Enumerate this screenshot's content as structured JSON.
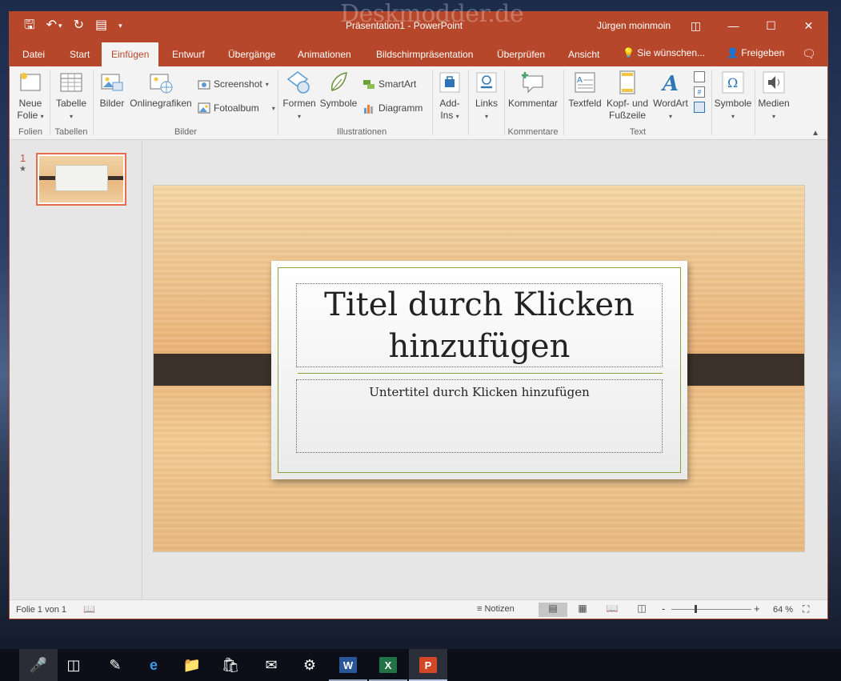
{
  "watermark": "Deskmodder.de",
  "window": {
    "title": "Präsentation1 - PowerPoint",
    "user": "Jürgen moinmoin",
    "accent": "#b7472a"
  },
  "tabs": [
    {
      "label": "Datei"
    },
    {
      "label": "Start"
    },
    {
      "label": "Einfügen"
    },
    {
      "label": "Entwurf"
    },
    {
      "label": "Übergänge"
    },
    {
      "label": "Animationen"
    },
    {
      "label": "Bildschirmpräsentation"
    },
    {
      "label": "Überprüfen"
    },
    {
      "label": "Ansicht"
    }
  ],
  "tell_me": "Sie wünschen...",
  "share": "Freigeben",
  "ribbon": {
    "neue_folie": {
      "line1": "Neue",
      "line2": "Folie"
    },
    "tabelle": "Tabelle",
    "bilder": "Bilder",
    "onlinegrafiken": "Onlinegrafiken",
    "screenshot": "Screenshot",
    "fotoalbum": "Fotoalbum",
    "formen": "Formen",
    "symbole_ill": "Symbole",
    "smartart": "SmartArt",
    "diagramm": "Diagramm",
    "addins": {
      "line1": "Add-",
      "line2": "Ins"
    },
    "links": "Links",
    "kommentar": "Kommentar",
    "textfeld": "Textfeld",
    "kopfzeile": {
      "line1": "Kopf- und",
      "line2": "Fußzeile"
    },
    "wordart": "WordArt",
    "symbole": "Symbole",
    "medien": "Medien",
    "groups": {
      "folien": "Folien",
      "tabellen": "Tabellen",
      "bilder": "Bilder",
      "illustrationen": "Illustrationen",
      "kommentare": "Kommentare",
      "text": "Text"
    }
  },
  "thumbnail": {
    "number": "1",
    "star": "★"
  },
  "slide": {
    "title_line1": "Titel durch Klicken",
    "title_line2": "hinzufügen",
    "subtitle": "Untertitel durch Klicken hinzufügen"
  },
  "status": {
    "slide_info": "Folie 1 von 1",
    "notes": "Notizen",
    "zoom": "64 %"
  }
}
